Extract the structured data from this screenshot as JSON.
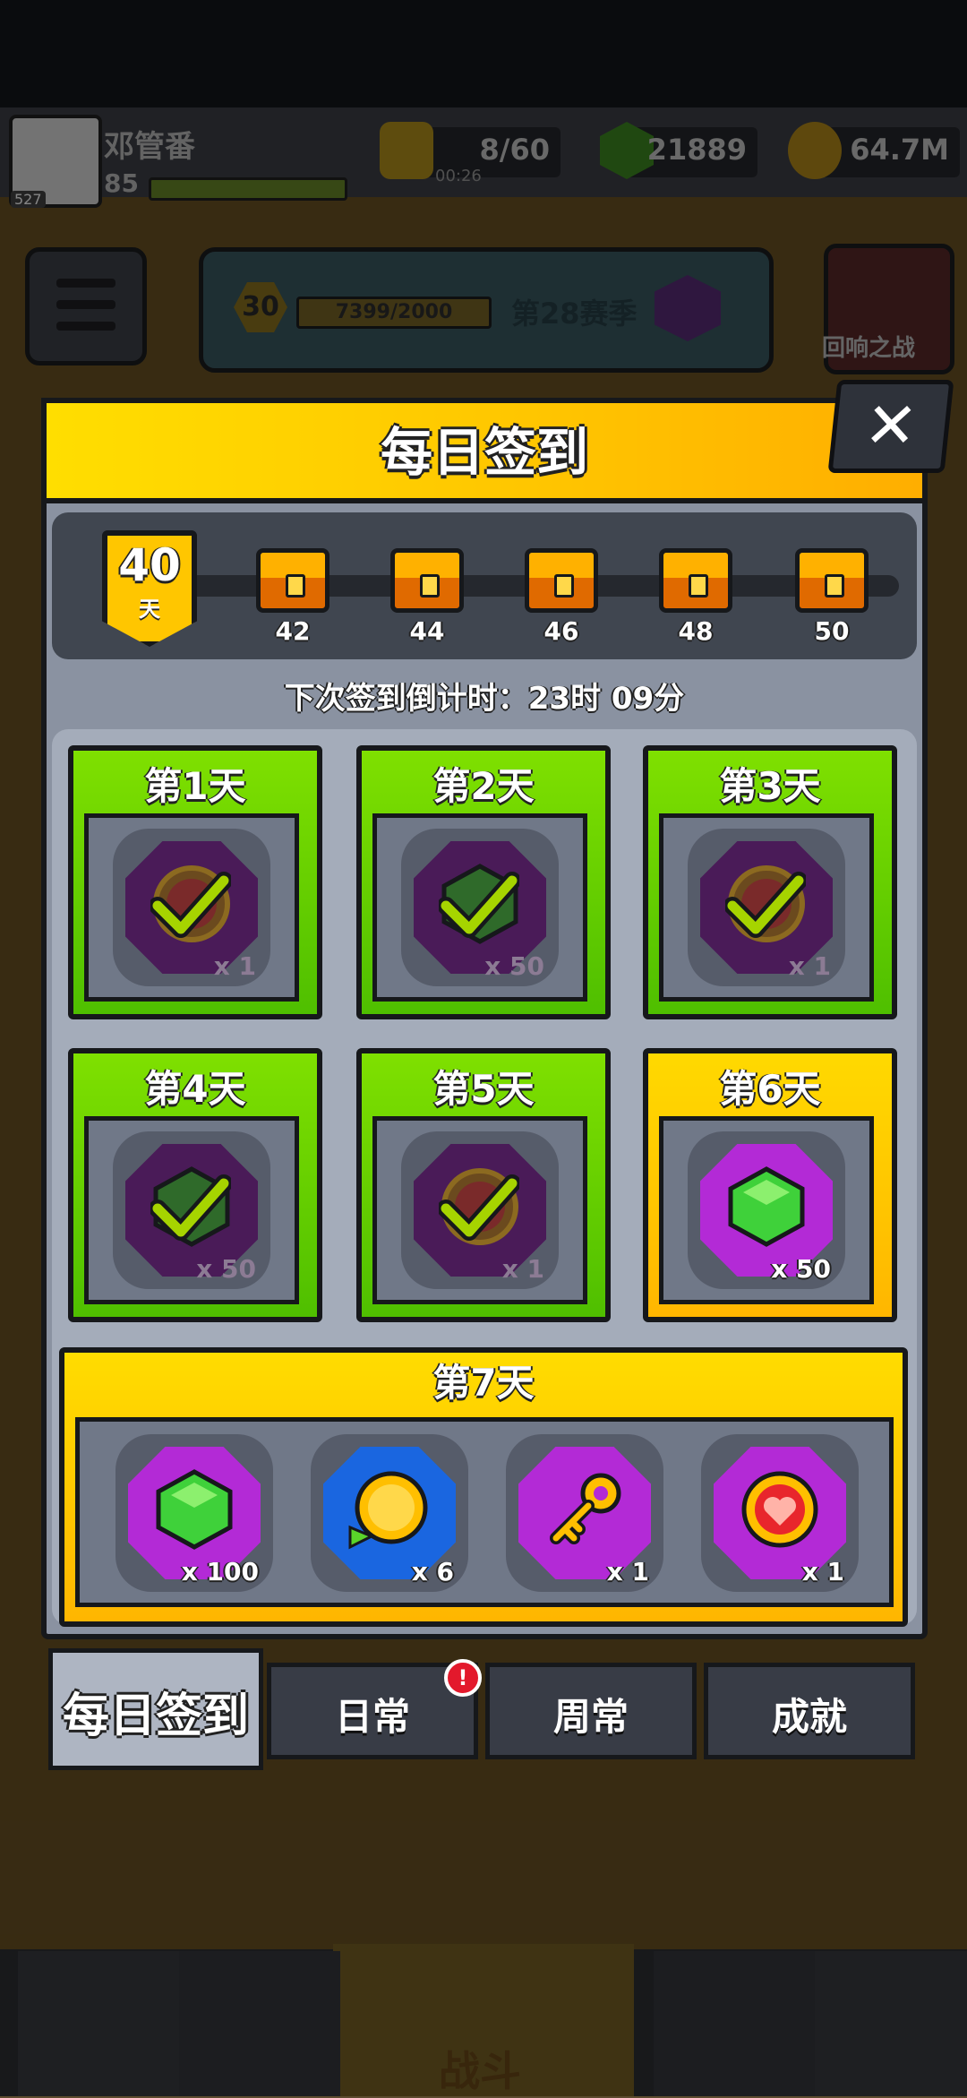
{
  "top_bar": {
    "username": "邓管番",
    "user_level": "85",
    "avatar_badge": "527",
    "energy": "8/60",
    "energy_timer": "00:26",
    "gems": "21889",
    "coins": "64.7M"
  },
  "lobby": {
    "season_level": "30",
    "season_progress": "7399/2000",
    "season_name": "第28赛季",
    "echo_battle": "回响之战",
    "battle_label": "战斗"
  },
  "modal": {
    "title": "每日签到",
    "close_label": "✕",
    "streak_days": "40",
    "streak_unit": "天",
    "milestones": [
      "42",
      "44",
      "46",
      "48",
      "50"
    ],
    "countdown": "下次签到倒计时：23时 09分",
    "days": [
      {
        "label": "第1天",
        "reward": "coin",
        "qty": "x 1",
        "state": "done"
      },
      {
        "label": "第2天",
        "reward": "gem",
        "qty": "x 50",
        "state": "done"
      },
      {
        "label": "第3天",
        "reward": "coin",
        "qty": "x 1",
        "state": "done"
      },
      {
        "label": "第4天",
        "reward": "gem",
        "qty": "x 50",
        "state": "done"
      },
      {
        "label": "第5天",
        "reward": "coin",
        "qty": "x 1",
        "state": "done"
      },
      {
        "label": "第6天",
        "reward": "gem",
        "qty": "x 50",
        "state": "today"
      }
    ],
    "day7": {
      "label": "第7天",
      "rewards": [
        {
          "icon": "gem-icon",
          "qty": "x 100"
        },
        {
          "icon": "gold-coin-icon",
          "qty": "x 6"
        },
        {
          "icon": "key-icon",
          "qty": "x 1"
        },
        {
          "icon": "heart-coin-icon",
          "qty": "x 1"
        }
      ]
    }
  },
  "tabs": [
    {
      "label": "每日签到",
      "active": true
    },
    {
      "label": "日常",
      "alert": "!"
    },
    {
      "label": "周常"
    },
    {
      "label": "成就"
    }
  ],
  "colors": {
    "done_green": "#6fd400",
    "today_yellow": "#ffc600",
    "header_yellow": "#ffd000",
    "alert_red": "#e3192c"
  }
}
